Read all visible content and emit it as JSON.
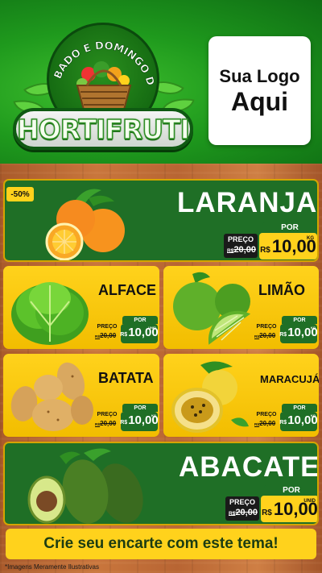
{
  "header": {
    "arc_text": "SÁBADO E DOMINGO DO",
    "brand": "HORTIFRUTI",
    "logo_line1": "Sua Logo",
    "logo_line2": "Aqui"
  },
  "products": {
    "laranja": {
      "name": "LARANJA",
      "discount": "-50%",
      "por": "POR",
      "preco": "PREÇO",
      "old": "20,00",
      "old_cur": "R$",
      "cur": "R$",
      "value": "10,00",
      "unit": "KG"
    },
    "alface": {
      "name": "ALFACE",
      "por": "POR",
      "preco": "PREÇO",
      "old": "20,00",
      "old_cur": "R$",
      "cur": "R$",
      "value": "10,00",
      "unit": "UNID"
    },
    "limao": {
      "name": "LIMÃO",
      "por": "POR",
      "preco": "PREÇO",
      "old": "20,00",
      "old_cur": "R$",
      "cur": "R$",
      "value": "10,00",
      "unit": "KG"
    },
    "batata": {
      "name": "BATATA",
      "por": "POR",
      "preco": "PREÇO",
      "old": "20,00",
      "old_cur": "R$",
      "cur": "R$",
      "value": "10,00",
      "unit": "KG"
    },
    "maracuja": {
      "name": "MARACUJÁ",
      "por": "POR",
      "preco": "PREÇO",
      "old": "20,00",
      "old_cur": "R$",
      "cur": "R$",
      "value": "10,00",
      "unit": "KG"
    },
    "abacate": {
      "name": "ABACATE",
      "por": "POR",
      "preco": "PREÇO",
      "old": "20,00",
      "old_cur": "R$",
      "cur": "R$",
      "value": "10,00",
      "unit": "UNID"
    }
  },
  "cta": "Crie seu encarte com este tema!",
  "footnote": "*Imagens Meramente Ilustrativas",
  "colors": {
    "green": "#1f6f26",
    "yellow": "#ffd21c",
    "header_green": "#1f9a1d"
  },
  "icons": [
    "orange-icon",
    "lettuce-icon",
    "lime-icon",
    "potato-icon",
    "passion-fruit-icon",
    "avocado-icon",
    "fruit-basket-icon"
  ]
}
